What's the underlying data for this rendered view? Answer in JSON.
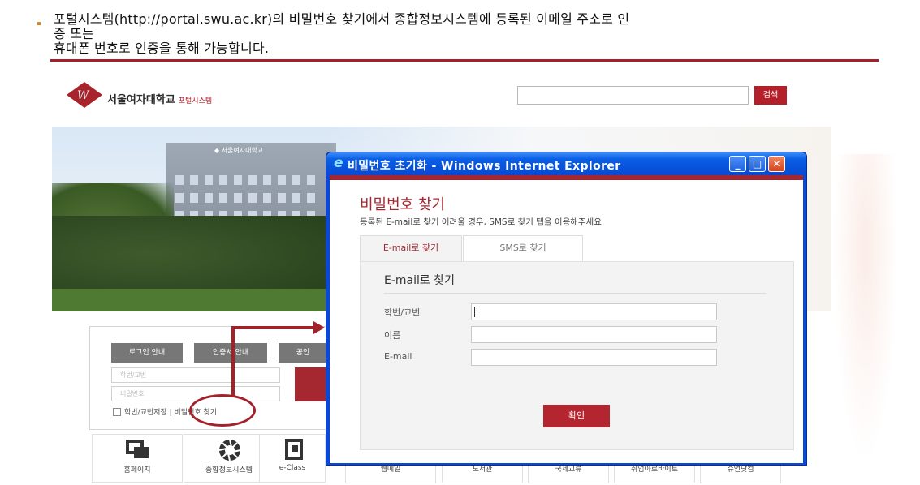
{
  "caption": {
    "line1": "포털시스템(http://portal.swu.ac.kr)의 비밀번호 찾기에서 종합정보시스템에 등록된 이메일 주소로 인",
    "line2": "증 또는",
    "line3": "휴대폰 번호로 인증을 통해 가능합니다."
  },
  "portal": {
    "logo_text": "서울여자대학교",
    "logo_sub": "포털시스템",
    "search_button": "검색",
    "building_sign": "◆ 서울여자대학교",
    "login": {
      "tab1": "로그인 안내",
      "tab2": "인증서 안내",
      "tab3": "공인",
      "id_placeholder": "학번/교번",
      "pw_placeholder": "비밀번호",
      "save_id": "학번/교번저장",
      "separator": "|",
      "find_pw": "비밀번호 찾기"
    },
    "quick_links": [
      {
        "label": "홈페이지",
        "icon": "homepage-icon"
      },
      {
        "label": "종합정보시스템",
        "icon": "aperture-icon"
      },
      {
        "label": "e-Class",
        "icon": "eclass-icon"
      },
      {
        "label": "웹메일",
        "icon": "mail-icon"
      },
      {
        "label": "도서관",
        "icon": "library-icon"
      },
      {
        "label": "국제교류",
        "icon": "globe-icon"
      },
      {
        "label": "취업아르바이트",
        "icon": "job-icon"
      },
      {
        "label": "슈언닷컴",
        "icon": "shop-icon"
      }
    ]
  },
  "popup": {
    "window_title": "비밀번호 초기화 - Windows Internet Explorer",
    "heading": "비밀번호 찾기",
    "description": "등록된 E-mail로 찾기 어려울 경우, SMS로 찾기 탭을 이용해주세요.",
    "tabs": [
      "E-mail로 찾기",
      "SMS로 찾기"
    ],
    "panel_title": "E-mail로 찾기",
    "fields": [
      {
        "label": "학번/교번",
        "value": ""
      },
      {
        "label": "이름",
        "value": ""
      },
      {
        "label": "E-mail",
        "value": ""
      }
    ],
    "confirm_button": "확인"
  },
  "colors": {
    "accent": "#a52730",
    "ie_titlebar": "#0749d2"
  }
}
